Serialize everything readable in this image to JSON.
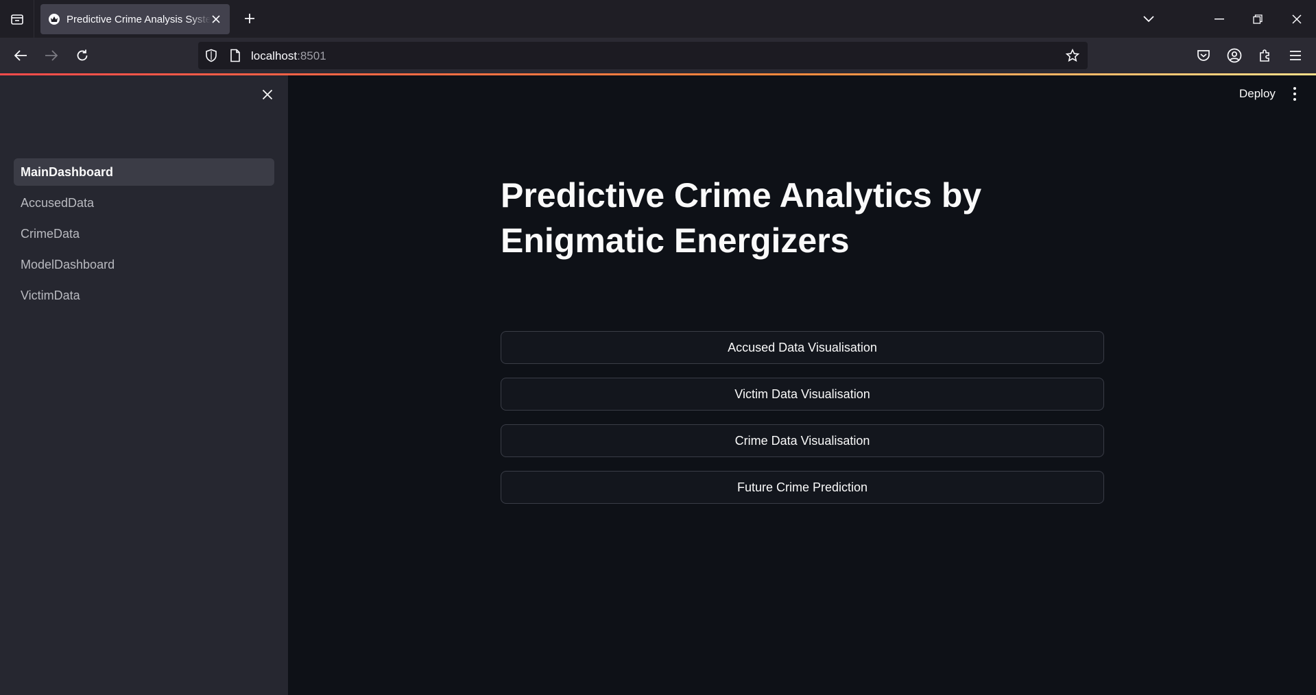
{
  "browser": {
    "tab_title": "Predictive Crime Analysis System",
    "url_host": "localhost",
    "url_port": ":8501"
  },
  "sidebar": {
    "items": [
      {
        "label": "MainDashboard",
        "active": true
      },
      {
        "label": "AccusedData",
        "active": false
      },
      {
        "label": "CrimeData",
        "active": false
      },
      {
        "label": "ModelDashboard",
        "active": false
      },
      {
        "label": "VictimData",
        "active": false
      }
    ]
  },
  "header": {
    "deploy_label": "Deploy"
  },
  "main": {
    "title": "Predictive Crime Analytics by Enigmatic Energizers",
    "buttons": [
      "Accused Data Visualisation",
      "Victim Data Visualisation",
      "Crime Data Visualisation",
      "Future Crime Prediction"
    ]
  },
  "colors": {
    "app_bg": "#0e1117",
    "sidebar_bg": "#262730",
    "accent": "#ff4b4b"
  }
}
